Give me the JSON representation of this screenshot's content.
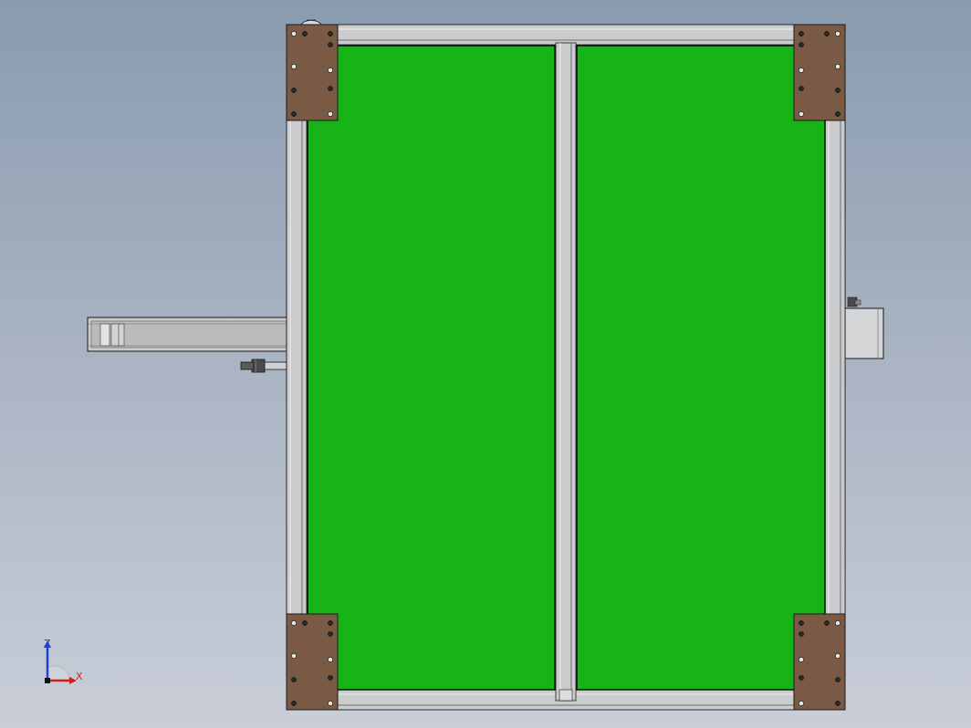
{
  "viewport": {
    "background_top": "#8a9bb0",
    "background_bottom": "#c9ced8"
  },
  "model": {
    "panel_color": "#17b417",
    "plate_color": "#7a5a44",
    "profile_color": "#c8cacb",
    "profile_dark": "#8e9092",
    "outline_color": "#1a1a1a"
  },
  "triad": {
    "z_label": "Z",
    "x_label": "X",
    "z_color": "#1f3fd6",
    "x_color": "#d11f1f",
    "y_color": "#cfd2d6"
  }
}
